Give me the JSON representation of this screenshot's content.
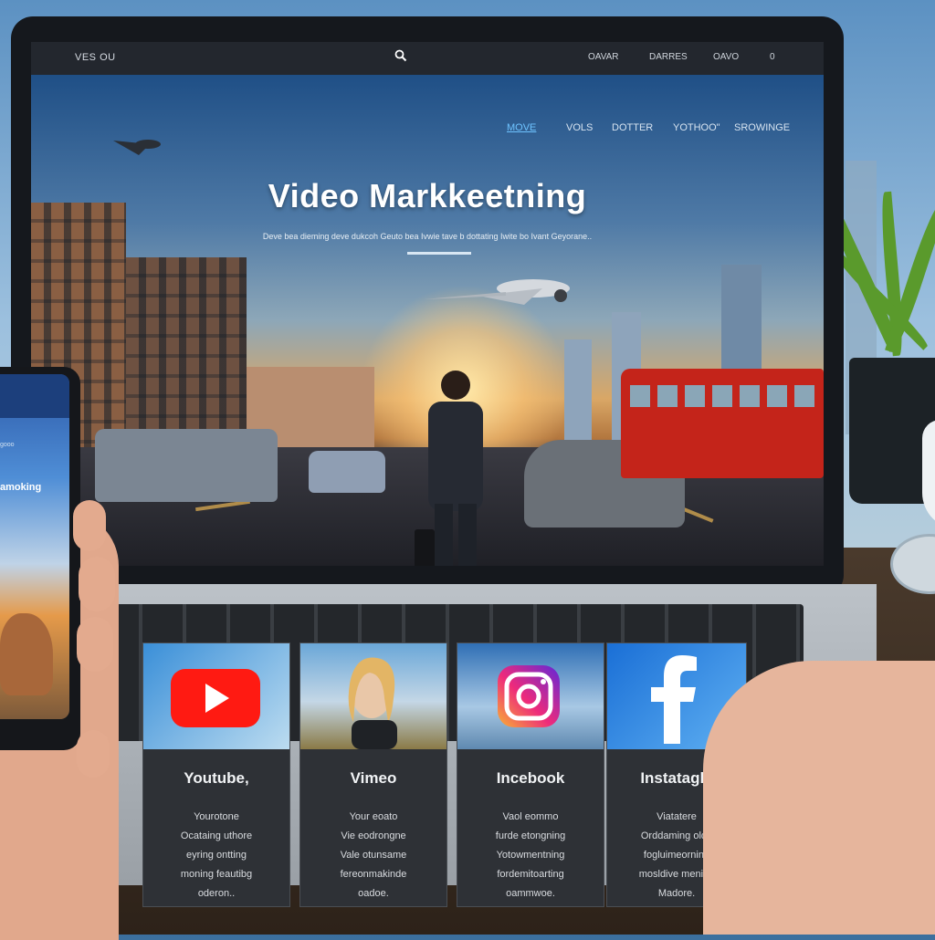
{
  "topbar": {
    "brand": "VES OU",
    "links": [
      "OAVAR",
      "DARRES",
      "OAVO",
      "0"
    ]
  },
  "hero": {
    "nav": [
      "MOVE",
      "VOLS",
      "DOTTER",
      "YOTHOO\"",
      "SROWINGE"
    ],
    "active_index": 0,
    "title": "Video Markkeetning",
    "subtitle": "Deve bea dieming deve dukcoh Geuto bea Ivwie tave b dottating Iwite bo Ivant Geyorane.."
  },
  "platforms": [
    {
      "name": "Youtube,",
      "icon": "youtube-icon",
      "desc": [
        "Yourotone",
        "Ocataing uthore",
        "eyring ontting",
        "moning feautibg",
        "oderon.."
      ]
    },
    {
      "name": "Vimeo",
      "icon": "vimeo-thumbnail",
      "desc": [
        "Your eoato",
        "Vie eodrongne",
        "Vale otunsame",
        "fereonmakinde",
        "oadoe."
      ]
    },
    {
      "name": "Incebook",
      "icon": "instagram-icon",
      "desc": [
        "Vaol eommo",
        "furde etongning",
        "Yotowmentning",
        "fordemitoarting",
        "oammwoe."
      ]
    },
    {
      "name": "Instatagle",
      "icon": "facebook-icon",
      "desc": [
        "Viatatere",
        "Orddaming olde",
        "fogluimeorning",
        "mosldive mening",
        "Madore."
      ]
    }
  ],
  "phone": {
    "small_label": "gooo",
    "title": "amoking"
  },
  "colors": {
    "youtube": "#ff0000",
    "facebook": "#1877f2",
    "active_link": "#6ec3ff"
  }
}
